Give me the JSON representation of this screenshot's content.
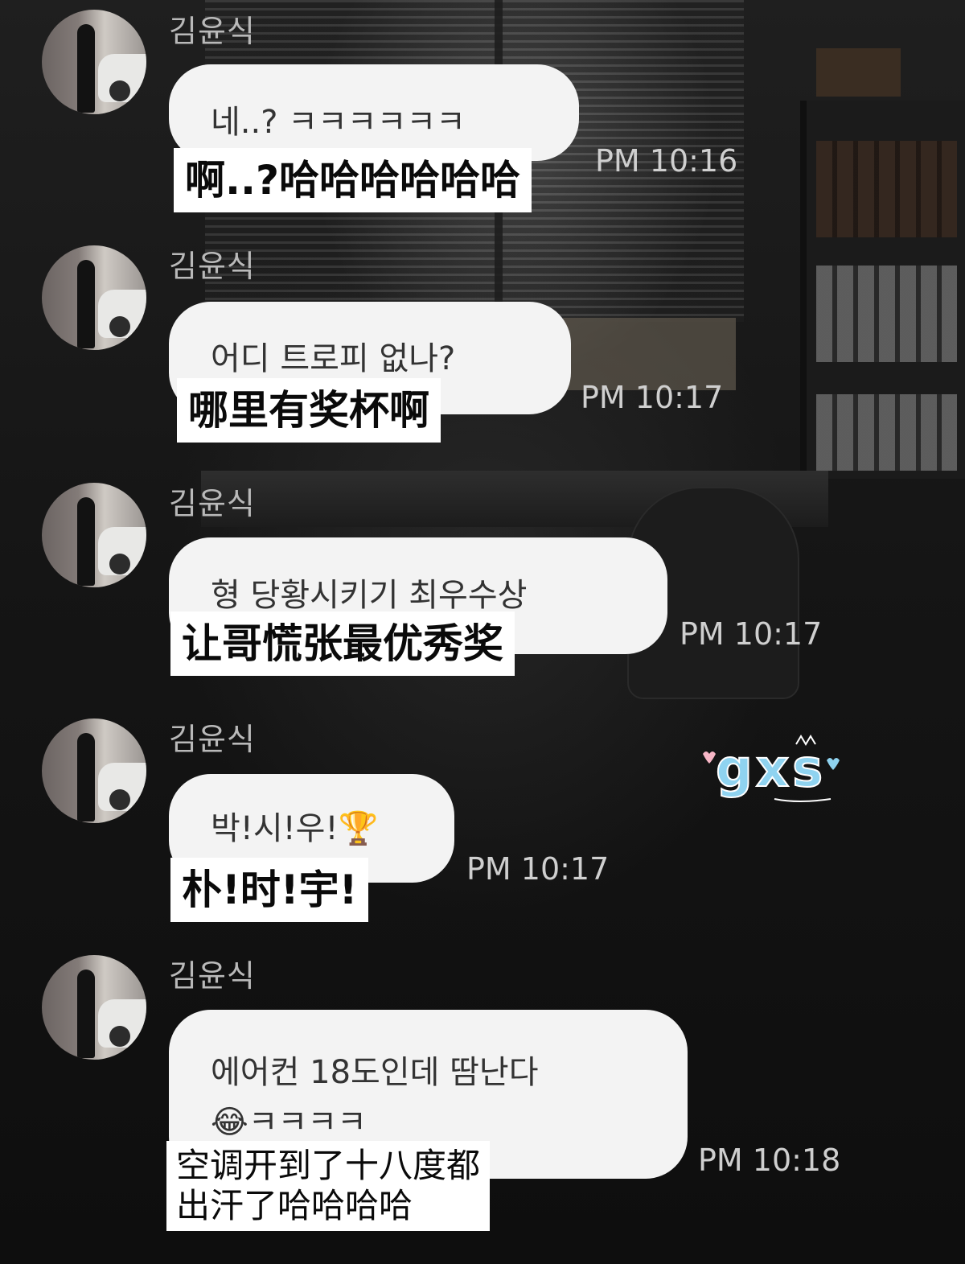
{
  "messages": [
    {
      "sender": "김윤식",
      "text": "네..? ㅋㅋㅋㅋㅋㅋ",
      "time": "PM 10:16",
      "translation": "啊..?哈哈哈哈哈哈"
    },
    {
      "sender": "김윤식",
      "text": "어디 트로피 없나?",
      "time": "PM 10:17",
      "translation": "哪里有奖杯啊"
    },
    {
      "sender": "김윤식",
      "text": "형 당황시키기 최우수상",
      "time": "PM 10:17",
      "translation": "让哥慌张最优秀奖"
    },
    {
      "sender": "김윤식",
      "text": "박!시!우!🏆",
      "time": "PM 10:17",
      "translation": "朴!时!宇!"
    },
    {
      "sender": "김윤식",
      "text": "에어컨 18도인데 땀난다\n😂ㅋㅋㅋㅋ",
      "time": "PM 10:18",
      "translation": "空调开到了十八度都\n出汗了哈哈哈哈"
    }
  ],
  "watermark": "gxs",
  "colors": {
    "bubble": "#f3f3f3",
    "bubble_text": "#333333",
    "sender": "#b9b9b9",
    "time": "#cfcfcf",
    "caption_bg": "#ffffff",
    "watermark_pink": "#f7b6c6",
    "watermark_blue": "#8fd3f0"
  }
}
